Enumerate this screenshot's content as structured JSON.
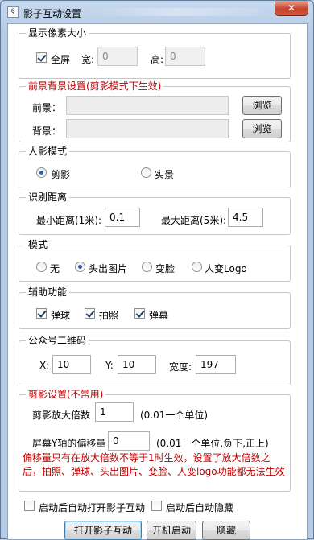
{
  "window": {
    "title": "影子互动设置",
    "app_icon_glyph": "§",
    "close_glyph": "✕"
  },
  "pixel_group": {
    "legend": "显示像素大小",
    "fullscreen_label": "全屏",
    "fullscreen_checked": true,
    "width_label": "宽:",
    "width_value": "0",
    "height_label": "高:",
    "height_value": "0"
  },
  "background_group": {
    "legend": "前景背景设置(剪影模式下生效)",
    "foreground_label": "前景：",
    "foreground_value": "",
    "background_label": "背景：",
    "background_value": "",
    "browse_label": "浏览"
  },
  "shadow_mode_group": {
    "legend": "人影模式",
    "options": [
      "剪影",
      "实景"
    ],
    "selected": "剪影"
  },
  "distance_group": {
    "legend": "识别距离",
    "min_label": "最小距离(1米):",
    "min_value": "0.1",
    "max_label": "最大距离(5米):",
    "max_value": "4.5"
  },
  "mode_group": {
    "legend": "模式",
    "options": [
      "无",
      "头出图片",
      "变脸",
      "人变Logo"
    ],
    "selected": "头出图片"
  },
  "aux_group": {
    "legend": "辅助功能",
    "items": [
      {
        "label": "弹球",
        "checked": true
      },
      {
        "label": "拍照",
        "checked": true
      },
      {
        "label": "弹幕",
        "checked": true
      }
    ]
  },
  "qr_group": {
    "legend": "公众号二维码",
    "x_label": "X:",
    "x_value": "10",
    "y_label": "Y:",
    "y_value": "10",
    "width_label": "宽度:",
    "width_value": "197"
  },
  "silhouette_group": {
    "legend": "剪影设置(不常用)",
    "zoom_label": "剪影放大倍数",
    "zoom_value": "1",
    "zoom_hint": "(0.01一个单位)",
    "offset_label": "屏幕Y轴的偏移量",
    "offset_value": "0",
    "offset_hint": "(0.01一个单位,负下,正上)",
    "warning": "偏移量只有在放大倍数不等于1时生效，设置了放大倍数之后，拍照、弹球、头出图片、变脸、人变logo功能都无法生效"
  },
  "startup": {
    "auto_open_label": "启动后自动打开影子互动",
    "auto_open_checked": false,
    "auto_hide_label": "启动后自动隐藏",
    "auto_hide_checked": false
  },
  "footer": {
    "open_label": "打开影子互动",
    "boot_label": "开机启动",
    "hide_label": "隐藏"
  }
}
